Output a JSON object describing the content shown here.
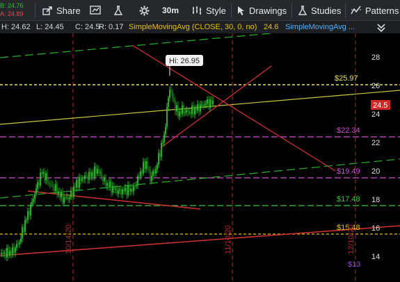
{
  "toolbar": {
    "bid": "B: 24.76",
    "ask": "A: 24.89",
    "share": "Share",
    "timeframe": "30m",
    "style": "Style",
    "drawings": "Drawings",
    "studies": "Studies",
    "patterns": "Patterns"
  },
  "infobar": {
    "high": "H: 24.62",
    "low": "L: 24.45",
    "close": "C: 24.5",
    "range": "R: 0.17",
    "study1": "SimpleMovingAvg (CLOSE, 30, 0, no)",
    "study1_value": "24.6",
    "study2": "SimpleMovingAvg ..."
  },
  "chart": {
    "high_callout": "Hi: 26.95",
    "last_price": "24.5",
    "y_ticks": [
      "28",
      "26",
      "24",
      "22",
      "20",
      "18",
      "16",
      "14"
    ],
    "levels": [
      {
        "label": "$25.97",
        "color": "#e8e060"
      },
      {
        "label": "$22.34",
        "color": "#d44ad4"
      },
      {
        "label": "$19.49",
        "color": "#d44ad4"
      },
      {
        "label": "$17.48",
        "color": "#3ac93a"
      },
      {
        "label": "$15.48",
        "color": "#e8c400"
      },
      {
        "label": "$13",
        "color": "#8a4ae8"
      }
    ],
    "date_labels": [
      "10/14/20",
      "11/10/20",
      "12/10/20"
    ]
  }
}
